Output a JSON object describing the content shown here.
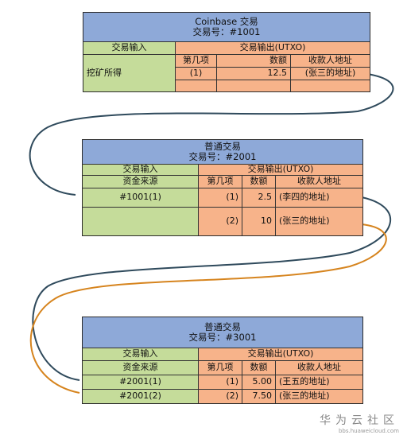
{
  "tx1": {
    "title": "Coinbase 交易",
    "id": "交易号：#1001",
    "input_header": "交易输入",
    "output_header": "交易输出(UTXO)",
    "col_index": "第几项",
    "col_amount": "数额",
    "col_addr": "收款人地址",
    "input_source": "挖矿所得",
    "rows": [
      {
        "index": "(1)",
        "amount": "12.5",
        "addr": "(张三的地址)"
      }
    ]
  },
  "tx2": {
    "title": "普通交易",
    "id": "交易号：#2001",
    "input_header": "交易输入",
    "output_header": "交易输出(UTXO)",
    "source_header": "资金来源",
    "col_index": "第几项",
    "col_amount": "数额",
    "col_addr": "收款人地址",
    "input_ref": "#1001(1)",
    "rows": [
      {
        "index": "(1)",
        "amount": "2.5",
        "addr": "(李四的地址)"
      },
      {
        "index": "(2)",
        "amount": "10",
        "addr": "(张三的地址)"
      }
    ]
  },
  "tx3": {
    "title": "普通交易",
    "id": "交易号：#3001",
    "input_header": "交易输入",
    "output_header": "交易输出(UTXO)",
    "source_header": "资金来源",
    "col_index": "第几项",
    "col_amount": "数额",
    "col_addr": "收款人地址",
    "rows": [
      {
        "ref": "#2001(1)",
        "index": "(1)",
        "amount": "5.00",
        "addr": "(王五的地址)"
      },
      {
        "ref": "#2001(2)",
        "index": "(2)",
        "amount": "7.50",
        "addr": "(张三的地址)"
      }
    ]
  },
  "colors": {
    "header": "#8ea9d8",
    "input": "#c5dc9a",
    "output": "#f7b38a",
    "link_dark": "#2f4a5c",
    "link_orange": "#d6841e"
  },
  "watermark": {
    "brand": "华为云社区",
    "url": "bbs.huaweicloud.com"
  }
}
